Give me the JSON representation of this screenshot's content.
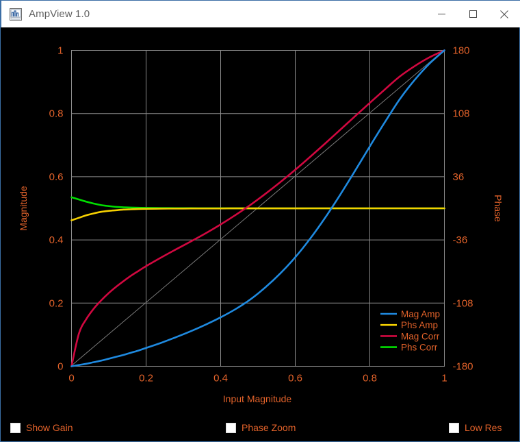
{
  "window": {
    "title": "AmpView 1.0",
    "icon": "app-waveform-icon",
    "border_color": "#3b6ea5",
    "titlebar_bg": "#ffffff",
    "titlebar_text_color": "#5f5f5f",
    "controls": [
      {
        "name": "minimize",
        "glyph": "—"
      },
      {
        "name": "maximize",
        "glyph": "□"
      },
      {
        "name": "close",
        "glyph": "✕"
      }
    ]
  },
  "theme": {
    "background": "#000000",
    "axis_text": "#e2622a",
    "grid": "#8c8c8c",
    "frame": "#8c8c8c",
    "identity_line": "#7a7a7a"
  },
  "controls": {
    "checkboxes": [
      {
        "label": "Show Gain",
        "checked": false
      },
      {
        "label": "Phase Zoom",
        "checked": false
      },
      {
        "label": "Low Res",
        "checked": false
      }
    ]
  },
  "chart_data": {
    "type": "line",
    "title": "",
    "xlabel": "Input Magnitude",
    "ylabel": "Magnitude",
    "y2label": "Phase",
    "xlim": [
      0,
      1
    ],
    "ylim": [
      0,
      1
    ],
    "y2lim": [
      -180,
      180
    ],
    "xticks": [
      "0",
      "0.2",
      "0.4",
      "0.6",
      "0.8",
      "1"
    ],
    "xtick_values": [
      0,
      0.2,
      0.4,
      0.6,
      0.8,
      1
    ],
    "yticks": [
      "0",
      "0.2",
      "0.4",
      "0.6",
      "0.8",
      "1"
    ],
    "ytick_values": [
      0,
      0.2,
      0.4,
      0.6,
      0.8,
      1
    ],
    "y2ticks": [
      "-180",
      "-108",
      "-36",
      "36",
      "108",
      "180"
    ],
    "y2tick_values": [
      -180,
      -108,
      -36,
      36,
      108,
      180
    ],
    "grid": true,
    "legend_position": "bottom-right",
    "legend": [
      "Mag Amp",
      "Phs Amp",
      "Mag Corr",
      "Phs Corr"
    ],
    "reference_line": {
      "name": "identity",
      "color": "#7a7a7a",
      "x": [
        0,
        1
      ],
      "y": [
        0,
        1
      ]
    },
    "x": [
      0,
      0.02,
      0.04,
      0.06,
      0.08,
      0.1,
      0.12,
      0.14,
      0.16,
      0.18,
      0.2,
      0.24,
      0.28,
      0.32,
      0.36,
      0.4,
      0.44,
      0.48,
      0.52,
      0.56,
      0.6,
      0.64,
      0.68,
      0.72,
      0.76,
      0.8,
      0.84,
      0.88,
      0.92,
      0.96,
      1
    ],
    "series": [
      {
        "name": "Mag Amp",
        "color": "#1f8ae0",
        "axis": "left",
        "values": [
          0.0,
          0.004,
          0.008,
          0.013,
          0.018,
          0.024,
          0.03,
          0.036,
          0.043,
          0.05,
          0.058,
          0.074,
          0.092,
          0.111,
          0.132,
          0.155,
          0.181,
          0.212,
          0.25,
          0.294,
          0.345,
          0.404,
          0.47,
          0.542,
          0.618,
          0.696,
          0.772,
          0.845,
          0.906,
          0.958,
          1.0
        ]
      },
      {
        "name": "Phs Amp",
        "color": "#f5d000",
        "axis": "right",
        "values": [
          0.462,
          0.47,
          0.478,
          0.484,
          0.489,
          0.492,
          0.494,
          0.496,
          0.497,
          0.498,
          0.4985,
          0.499,
          0.4993,
          0.4995,
          0.4996,
          0.4997,
          0.4998,
          0.4998,
          0.4999,
          0.4999,
          0.4999,
          0.5,
          0.5,
          0.5,
          0.5,
          0.5,
          0.5,
          0.5,
          0.5,
          0.5,
          0.5
        ]
      },
      {
        "name": "Mag Corr",
        "color": "#d10840",
        "axis": "left",
        "values": [
          0.0,
          0.104,
          0.15,
          0.183,
          0.209,
          0.232,
          0.252,
          0.27,
          0.287,
          0.302,
          0.317,
          0.344,
          0.37,
          0.395,
          0.421,
          0.449,
          0.479,
          0.511,
          0.546,
          0.583,
          0.622,
          0.663,
          0.705,
          0.748,
          0.791,
          0.834,
          0.876,
          0.917,
          0.95,
          0.978,
          1.0
        ]
      },
      {
        "name": "Phs Corr",
        "color": "#00dd00",
        "axis": "right",
        "values": [
          0.535,
          0.528,
          0.521,
          0.515,
          0.51,
          0.507,
          0.5045,
          0.5032,
          0.5023,
          0.5017,
          0.5013,
          0.5008,
          0.5005,
          0.5003,
          0.5002,
          0.5001,
          0.5001,
          0.5,
          0.5,
          0.5,
          0.5,
          0.5,
          0.5,
          0.5,
          0.5,
          0.5,
          0.5,
          0.5,
          0.5,
          0.5,
          0.5
        ]
      }
    ]
  }
}
